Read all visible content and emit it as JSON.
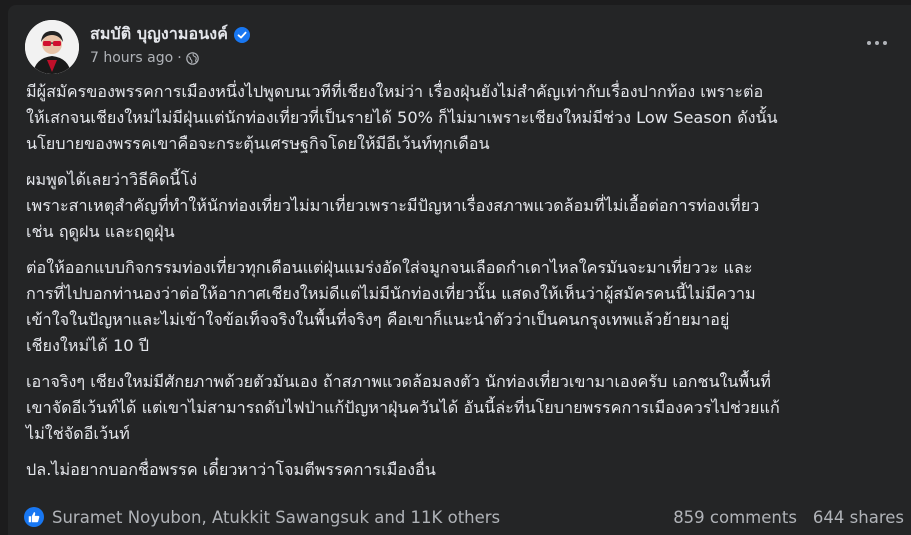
{
  "post": {
    "author": "สมบัติ บุญงามอนงค์",
    "time": "7 hours ago",
    "separator": "·",
    "paragraphs": [
      "มีผู้สมัครของพรรคการเมืองหนึ่งไปพูดบนเวทีที่เชียงใหม่ว่า เรื่องฝุ่นยังไม่สำคัญเท่ากับเรื่องปากท้อง เพราะต่อ\nให้เสกจนเชียงใหม่ไม่มีฝุ่นแต่นักท่องเที่ยวที่เป็นรายได้ 50% ก็ไม่มาเพราะเชียงใหม่มีช่วง Low Season ดังนั้น\nนโยบายของพรรคเขาคือจะกระตุ้นเศรษฐกิจโดยให้มีอีเว้นท์ทุกเดือน",
      "ผมพูดได้เลยว่าวิธีคิดนี้โง่\nเพราะสาเหตุสำคัญที่ทำให้นักท่องเที่ยวไม่มาเที่ยวเพราะมีปัญหาเรื่องสภาพแวดล้อมที่ไม่เอื้อต่อการท่องเที่ยว\nเช่น ฤดูฝน และฤดูฝุ่น",
      "ต่อให้ออกแบบกิจกรรมท่องเที่ยวทุกเดือนแต่ฝุ่นแมร่งอัดใส่จมูกจนเลือดกำเดาไหลใครมันจะมาเที่ยววะ และ\nการที่ไปบอกท่านองว่าต่อให้อากาศเชียงใหม่ดีแต่ไม่มีนักท่องเที่ยวนั้น แสดงให้เห็นว่าผู้สมัครคนนี้ไม่มีความ\nเข้าใจในปัญหาและไม่เข้าใจข้อเท็จจริงในพื้นที่จริงๆ คือเขาก็แนะนำตัวว่าเป็นคนกรุงเทพแล้วย้ายมาอยู่\nเชียงใหม่ได้ 10 ปี",
      "เอาจริงๆ เชียงใหม่มีศักยภาพด้วยตัวมันเอง ถ้าสภาพแวดล้อมลงตัว นักท่องเที่ยวเขามาเองครับ เอกชนในพื้นที่\nเขาจัดอีเว้นท์ได้ แต่เขาไม่สามารถดับไฟป่าแก้ปัญหาฝุ่นควันได้ อันนี้ล่ะที่นโยบายพรรคการเมืองควรไปช่วยแก้\nไม่ใช่จัดอีเว้นท์",
      "ปล.ไม่อยากบอกชื่อพรรค เดี๋ยวหาว่าโจมตีพรรคการเมืองอื่น"
    ]
  },
  "footer": {
    "reactors": "Suramet Noyubon, Atukkit Sawangsuk and 11K others",
    "comments": "859 comments",
    "shares": "644 shares"
  },
  "icons": {
    "verified": "verified-badge-icon",
    "privacy": "globe-icon",
    "more": "more-options-icon",
    "like": "like-reaction-icon"
  },
  "colors": {
    "background": "#242526",
    "text": "#e4e6eb",
    "secondary": "#b0b3b8",
    "accent": "#1877f2"
  }
}
